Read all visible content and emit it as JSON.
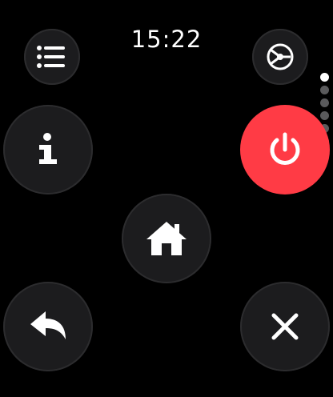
{
  "status_bar": {
    "time": "15:22"
  },
  "pager": {
    "dots": [
      true,
      false,
      false,
      false,
      false,
      false
    ]
  },
  "buttons": {
    "list_icon": "list-icon",
    "settings_icon": "steering-wheel-icon",
    "info_icon": "info-icon",
    "power_icon": "power-icon",
    "home_icon": "home-icon",
    "back_icon": "reply-back-icon",
    "close_icon": "close-x-icon"
  },
  "colors": {
    "background": "#000000",
    "button": "#1c1c1e",
    "power": "#ff3b45"
  }
}
